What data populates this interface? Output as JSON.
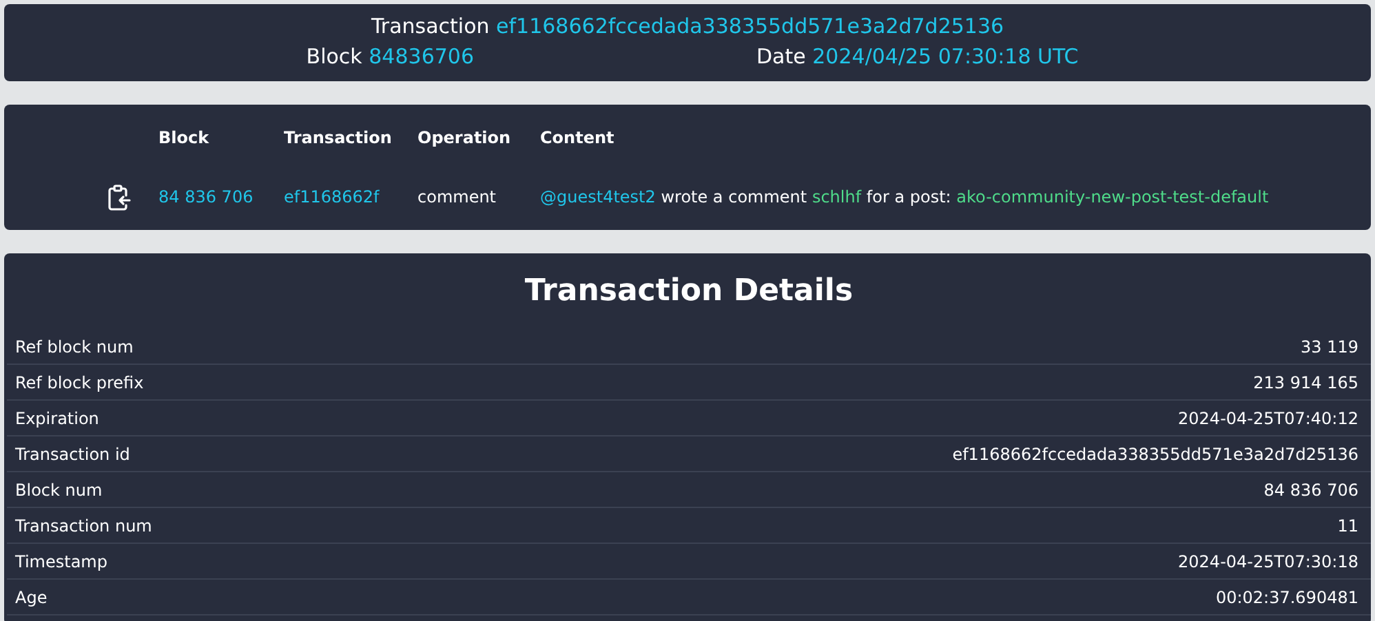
{
  "header": {
    "transaction_label": "Transaction",
    "transaction_id": "ef1168662fccedada338355dd571e3a2d7d25136",
    "block_label": "Block",
    "block": "84836706",
    "date_label": "Date",
    "date": "2024/04/25 07:30:18 UTC"
  },
  "operations": {
    "columns": [
      "Block",
      "Transaction",
      "Operation",
      "Content"
    ],
    "rows": [
      {
        "block": "84 836 706",
        "transaction": "ef1168662f",
        "operation": "comment",
        "content": [
          {
            "kind": "account",
            "text": "@guest4test2"
          },
          {
            "kind": "text",
            "text": " wrote a comment "
          },
          {
            "kind": "permlink",
            "text": "schlhf"
          },
          {
            "kind": "text",
            "text": " for a post: "
          },
          {
            "kind": "permlink",
            "text": "ako-community-new-post-test-default"
          }
        ]
      }
    ]
  },
  "details": {
    "title": "Transaction Details",
    "rows": [
      {
        "label": "Ref block num",
        "value": "33 119"
      },
      {
        "label": "Ref block prefix",
        "value": "213 914 165"
      },
      {
        "label": "Expiration",
        "value": "2024-04-25T07:40:12"
      },
      {
        "label": "Transaction id",
        "value": "ef1168662fccedada338355dd571e3a2d7d25136"
      },
      {
        "label": "Block num",
        "value": "84 836 706"
      },
      {
        "label": "Transaction num",
        "value": "11"
      },
      {
        "label": "Timestamp",
        "value": "2024-04-25T07:30:18"
      },
      {
        "label": "Age",
        "value": "00:02:37.690481"
      }
    ]
  }
}
